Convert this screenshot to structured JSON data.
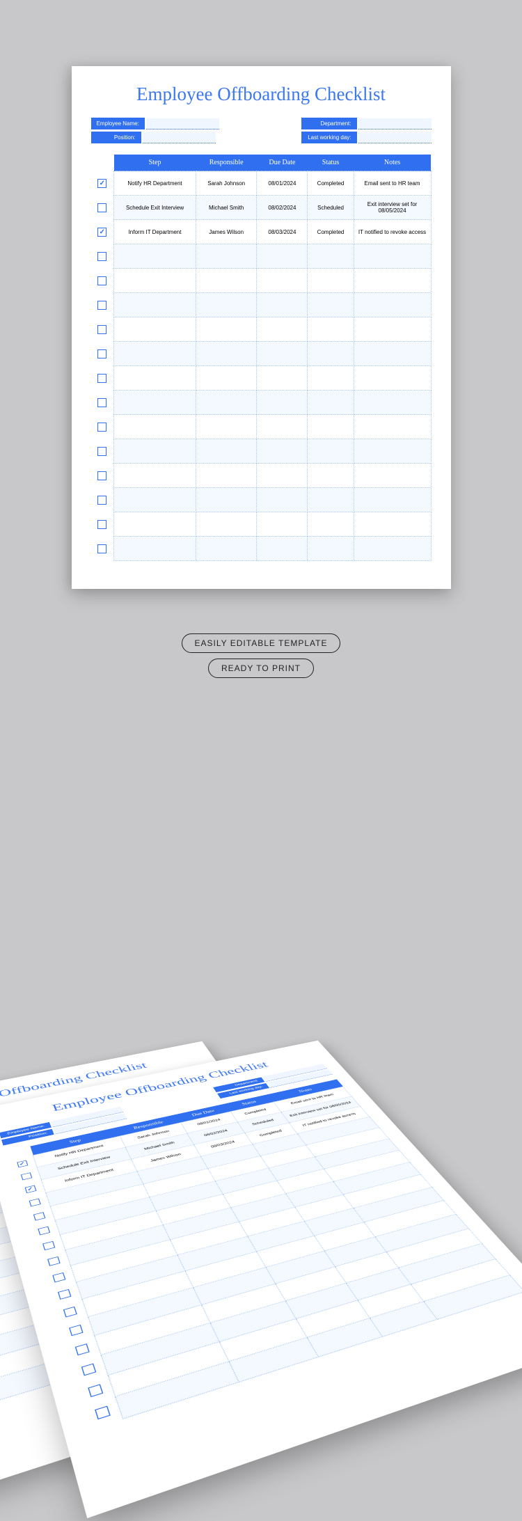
{
  "title": "Employee Offboarding Checklist",
  "fields": {
    "employee_name": "Employee Name:",
    "position": "Position:",
    "department": "Department:",
    "last_working_day": "Last working day:"
  },
  "columns": {
    "step": "Step",
    "responsible": "Responsible",
    "due_date": "Due Date",
    "status": "Status",
    "notes": "Notes"
  },
  "rows": [
    {
      "checked": true,
      "step": "Notify HR Department",
      "responsible": "Sarah Johnson",
      "due_date": "08/01/2024",
      "status": "Completed",
      "notes": "Email sent to HR team"
    },
    {
      "checked": false,
      "step": "Schedule Exit Interview",
      "responsible": "Michael Smith",
      "due_date": "08/02/2024",
      "status": "Scheduled",
      "notes": "Exit interview set for 08/05/2024"
    },
    {
      "checked": true,
      "step": "Inform IT Department",
      "responsible": "James Wilson",
      "due_date": "08/03/2024",
      "status": "Completed",
      "notes": "IT notified to revoke access"
    },
    {
      "checked": false,
      "step": "",
      "responsible": "",
      "due_date": "",
      "status": "",
      "notes": ""
    },
    {
      "checked": false,
      "step": "",
      "responsible": "",
      "due_date": "",
      "status": "",
      "notes": ""
    },
    {
      "checked": false,
      "step": "",
      "responsible": "",
      "due_date": "",
      "status": "",
      "notes": ""
    },
    {
      "checked": false,
      "step": "",
      "responsible": "",
      "due_date": "",
      "status": "",
      "notes": ""
    },
    {
      "checked": false,
      "step": "",
      "responsible": "",
      "due_date": "",
      "status": "",
      "notes": ""
    },
    {
      "checked": false,
      "step": "",
      "responsible": "",
      "due_date": "",
      "status": "",
      "notes": ""
    },
    {
      "checked": false,
      "step": "",
      "responsible": "",
      "due_date": "",
      "status": "",
      "notes": ""
    },
    {
      "checked": false,
      "step": "",
      "responsible": "",
      "due_date": "",
      "status": "",
      "notes": ""
    },
    {
      "checked": false,
      "step": "",
      "responsible": "",
      "due_date": "",
      "status": "",
      "notes": ""
    },
    {
      "checked": false,
      "step": "",
      "responsible": "",
      "due_date": "",
      "status": "",
      "notes": ""
    },
    {
      "checked": false,
      "step": "",
      "responsible": "",
      "due_date": "",
      "status": "",
      "notes": ""
    },
    {
      "checked": false,
      "step": "",
      "responsible": "",
      "due_date": "",
      "status": "",
      "notes": ""
    },
    {
      "checked": false,
      "step": "",
      "responsible": "",
      "due_date": "",
      "status": "",
      "notes": ""
    }
  ],
  "badges": {
    "editable": "EASILY EDITABLE TEMPLATE",
    "print": "READY TO PRINT"
  }
}
